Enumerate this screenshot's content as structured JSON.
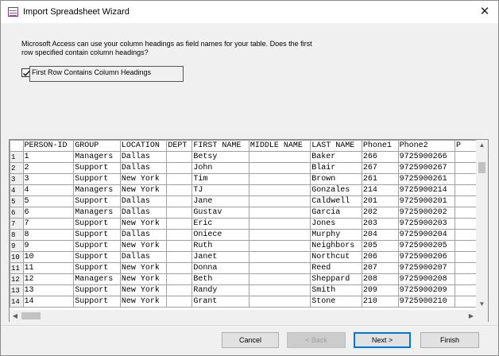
{
  "window": {
    "title": "Import Spreadsheet Wizard",
    "close_glyph": "✕"
  },
  "description": "Microsoft Access can use your column headings as field names for your table. Does the first row specified contain column headings?",
  "checkbox": {
    "label": "First Row Contains Column Headings",
    "checked": true
  },
  "grid": {
    "columns": [
      "PERSON-ID",
      "GROUP",
      "LOCATION",
      "DEPT",
      "FIRST NAME",
      "MIDDLE NAME",
      "LAST NAME",
      "Phone1",
      "Phone2",
      "P"
    ],
    "rows": [
      [
        "1",
        "1",
        "Managers",
        "Dallas",
        "",
        "Betsy",
        "",
        "Baker",
        "266",
        "9725900266"
      ],
      [
        "2",
        "2",
        "Support",
        "Dallas",
        "",
        "John",
        "",
        "Blair",
        "267",
        "9725900267"
      ],
      [
        "3",
        "3",
        "Support",
        "New York",
        "",
        "Tim",
        "",
        "Brown",
        "261",
        "9725900261"
      ],
      [
        "4",
        "4",
        "Managers",
        "New York",
        "",
        "TJ",
        "",
        "Gonzales",
        "214",
        "9725900214"
      ],
      [
        "5",
        "5",
        "Support",
        "Dallas",
        "",
        "Jane",
        "",
        "Caldwell",
        "201",
        "9725900201"
      ],
      [
        "6",
        "6",
        "Managers",
        "Dallas",
        "",
        "Gustav",
        "",
        "Garcia",
        "202",
        "9725900202"
      ],
      [
        "7",
        "7",
        "Support",
        "New York",
        "",
        "Eric",
        "",
        "Jones",
        "203",
        "9725900203"
      ],
      [
        "8",
        "8",
        "Support",
        "Dallas",
        "",
        "Oniece",
        "",
        "Murphy",
        "204",
        "9725900204"
      ],
      [
        "9",
        "9",
        "Support",
        "New York",
        "",
        "Ruth",
        "",
        "Neighbors",
        "205",
        "9725900205"
      ],
      [
        "10",
        "10",
        "Support",
        "Dallas",
        "",
        "Janet",
        "",
        "Northcut",
        "206",
        "9725900206"
      ],
      [
        "11",
        "11",
        "Support",
        "New York",
        "",
        "Donna",
        "",
        "Reed",
        "207",
        "9725900207"
      ],
      [
        "12",
        "12",
        "Managers",
        "New York",
        "",
        "Beth",
        "",
        "Sheppard",
        "208",
        "9725900208"
      ],
      [
        "13",
        "13",
        "Support",
        "New York",
        "",
        "Randy",
        "",
        "Smith",
        "209",
        "9725900209"
      ],
      [
        "14",
        "14",
        "Support",
        "New York",
        "",
        "Grant",
        "",
        "Stone",
        "210",
        "9725900210"
      ]
    ]
  },
  "buttons": {
    "cancel": "Cancel",
    "back": "< Back",
    "next": "Next >",
    "finish": "Finish"
  },
  "icons": {
    "app": "spreadsheet-import-icon",
    "up": "▲",
    "down": "▼",
    "left": "◀",
    "right": "▶"
  }
}
